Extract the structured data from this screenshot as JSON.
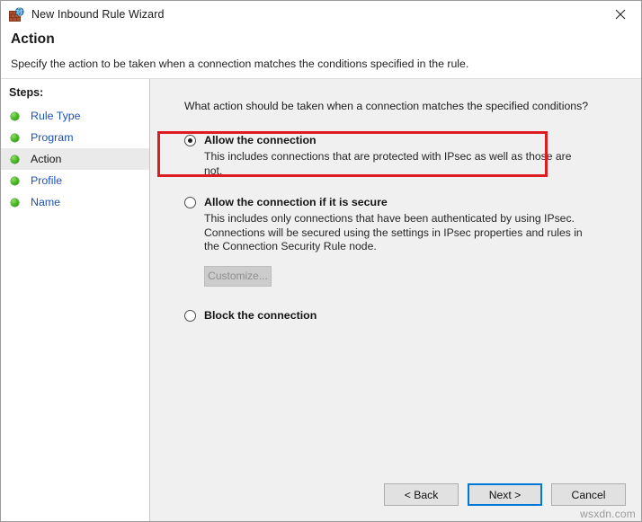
{
  "window": {
    "title": "New Inbound Rule Wizard",
    "app_icon": "firewall-globe-icon",
    "close_label": "×"
  },
  "header": {
    "title": "Action",
    "description": "Specify the action to be taken when a connection matches the conditions specified in the rule."
  },
  "sidebar": {
    "heading": "Steps:",
    "items": [
      {
        "label": "Rule Type",
        "state": "completed"
      },
      {
        "label": "Program",
        "state": "completed"
      },
      {
        "label": "Action",
        "state": "current"
      },
      {
        "label": "Profile",
        "state": "completed"
      },
      {
        "label": "Name",
        "state": "completed"
      }
    ]
  },
  "main": {
    "question": "What action should be taken when a connection matches the specified conditions?",
    "options": [
      {
        "label": "Allow the connection",
        "description": "This includes connections that are protected with IPsec as well as those are not.",
        "selected": true,
        "highlighted": true
      },
      {
        "label": "Allow the connection if it is secure",
        "description": "This includes only connections that have been authenticated by using IPsec.  Connections will be secured using the settings in IPsec properties and rules in the Connection Security Rule node.",
        "selected": false,
        "highlighted": false,
        "customize_label": "Customize...",
        "customize_disabled": true
      },
      {
        "label": "Block the connection",
        "description": "",
        "selected": false,
        "highlighted": false
      }
    ]
  },
  "footer": {
    "back_label": "< Back",
    "next_label": "Next >",
    "cancel_label": "Cancel",
    "focused_button": "next"
  },
  "watermark": {
    "text": "wsxdn.com"
  },
  "colors": {
    "annotation": "#dd1b21",
    "focus": "#0078d7",
    "link": "#1b52b5",
    "panel_bg": "#f0f0f0",
    "bullet_green": "#4cbb23"
  }
}
